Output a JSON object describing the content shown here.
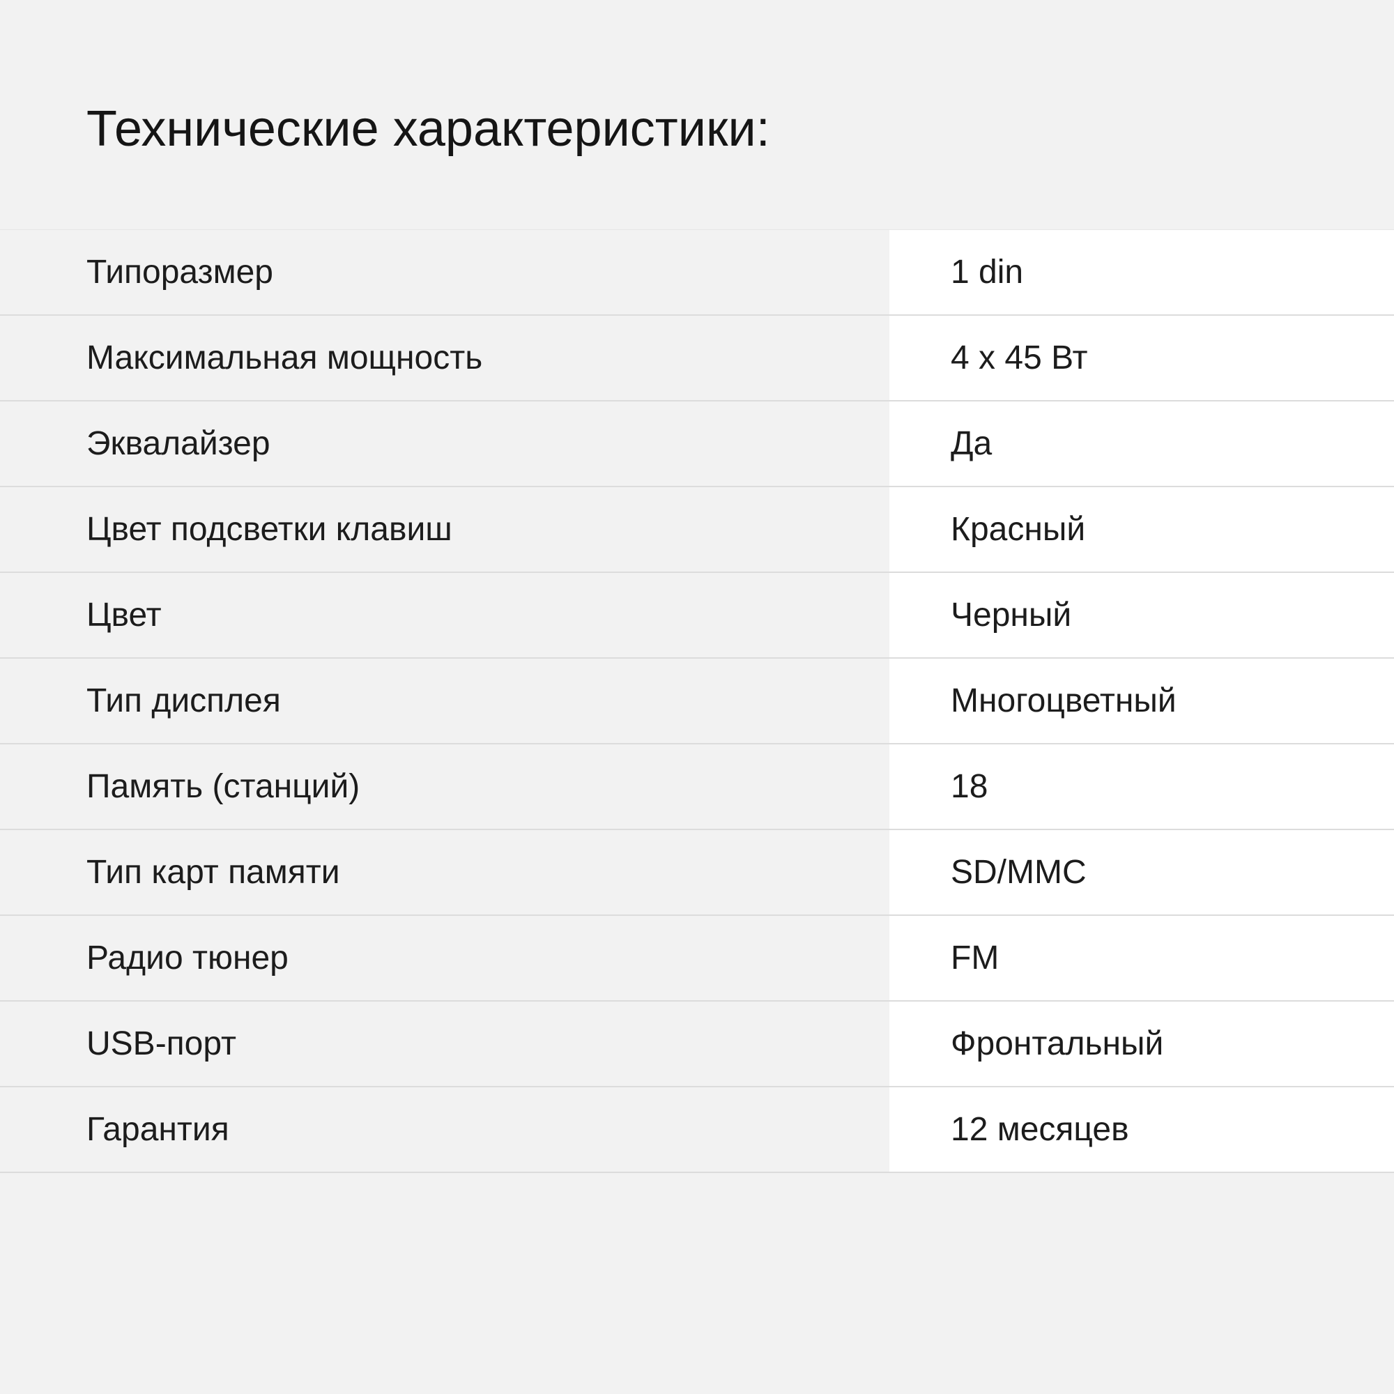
{
  "title": "Технические характеристики:",
  "specs": [
    {
      "name": "Типоразмер",
      "value": "1 din"
    },
    {
      "name": "Максимальная мощность",
      "value": "4 x 45 Вт"
    },
    {
      "name": "Эквалайзер",
      "value": "Да"
    },
    {
      "name": "Цвет подсветки клавиш",
      "value": "Красный"
    },
    {
      "name": "Цвет",
      "value": "Черный"
    },
    {
      "name": "Тип дисплея",
      "value": "Многоцветный"
    },
    {
      "name": "Память (станций)",
      "value": "18"
    },
    {
      "name": "Тип карт памяти",
      "value": "SD/MMC"
    },
    {
      "name": "Радио тюнер",
      "value": "FM"
    },
    {
      "name": "USB-порт",
      "value": "Фронтальный"
    },
    {
      "name": "Гарантия",
      "value": "12 месяцев"
    }
  ]
}
